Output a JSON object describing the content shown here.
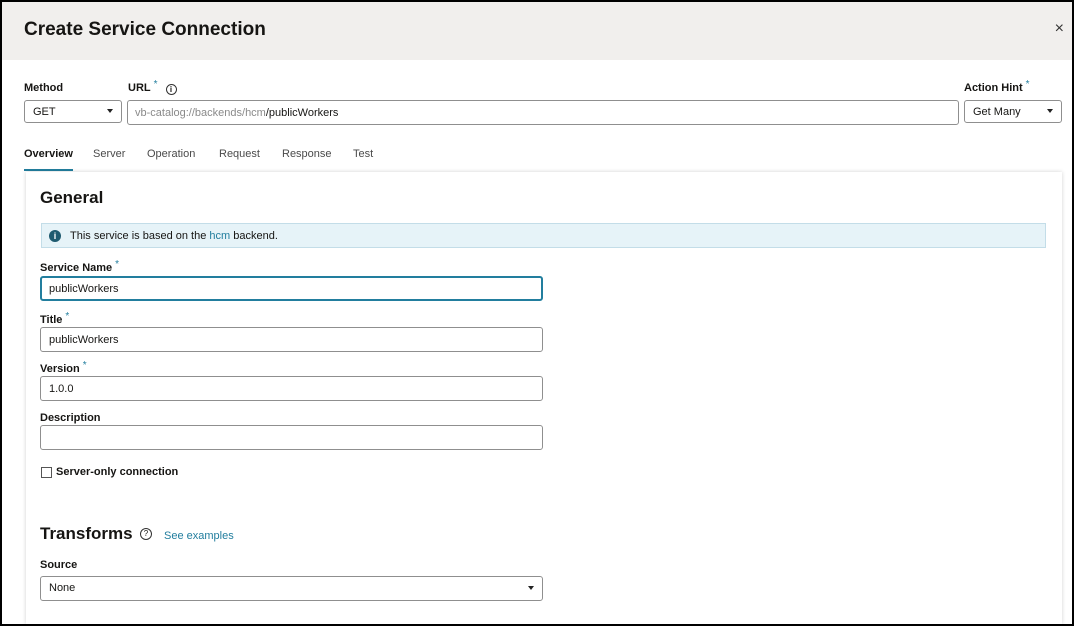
{
  "dialog": {
    "title": "Create Service Connection",
    "close_glyph": "×"
  },
  "method": {
    "label": "Method",
    "value": "GET"
  },
  "url": {
    "label": "URL",
    "required_mark": "*",
    "info_glyph": "i",
    "prefix": "vb-catalog://backends/hcm",
    "path": "/publicWorkers"
  },
  "action_hint": {
    "label": "Action Hint",
    "required_mark": "*",
    "value": "Get Many"
  },
  "tabs": [
    {
      "label": "Overview"
    },
    {
      "label": "Server"
    },
    {
      "label": "Operation"
    },
    {
      "label": "Request"
    },
    {
      "label": "Response"
    },
    {
      "label": "Test"
    }
  ],
  "general": {
    "title": "General",
    "banner": {
      "icon_glyph": "i",
      "text_before": "This service is based on the",
      "link": "hcm",
      "text_after": "backend."
    }
  },
  "form": {
    "service_name": {
      "label": "Service Name",
      "required_mark": "*",
      "value": "publicWorkers"
    },
    "title": {
      "label": "Title",
      "required_mark": "*",
      "value": "publicWorkers"
    },
    "version": {
      "label": "Version",
      "required_mark": "*",
      "value": "1.0.0"
    },
    "description": {
      "label": "Description",
      "value": ""
    },
    "server_only": {
      "label": "Server-only connection",
      "checked": false
    }
  },
  "transforms": {
    "title": "Transforms",
    "help_glyph": "?",
    "see_examples": "See examples",
    "source": {
      "label": "Source",
      "value": "None"
    }
  },
  "colors": {
    "accent": "#227e9e",
    "header_bg": "#f1efed",
    "banner_bg": "#e6f3f8"
  }
}
